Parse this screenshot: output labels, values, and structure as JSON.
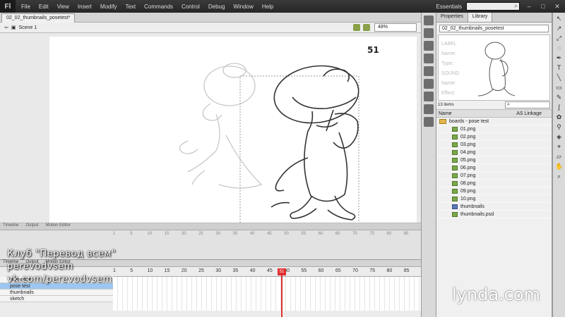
{
  "menubar": {
    "logo": "Fl",
    "items": [
      "File",
      "Edit",
      "View",
      "Insert",
      "Modify",
      "Text",
      "Commands",
      "Control",
      "Debug",
      "Window",
      "Help"
    ],
    "workspace": "Essentials",
    "search_icon": "search-icon"
  },
  "document": {
    "tab_label": "02_02_thumbnails_posetest*",
    "scene_label": "Scene 1",
    "zoom": "48%",
    "frame_badge": "51"
  },
  "timeline_ghost": {
    "tabs": [
      "Timeline",
      "Output",
      "Motion Editor"
    ],
    "ruler": [
      "1",
      "5",
      "10",
      "15",
      "20",
      "25",
      "30",
      "35",
      "40",
      "45",
      "50",
      "55",
      "60",
      "65",
      "70",
      "75",
      "80",
      "85"
    ]
  },
  "timeline": {
    "tabs": [
      "Timeline",
      "Output",
      "Motion Editor"
    ],
    "ruler": [
      "1",
      "5",
      "10",
      "15",
      "20",
      "25",
      "30",
      "35",
      "40",
      "45",
      "50",
      "55",
      "60",
      "65",
      "70",
      "75",
      "80",
      "85"
    ],
    "playhead_frame": "51",
    "layers": [
      "reference",
      "pose test",
      "thumbnails",
      "sketch"
    ]
  },
  "watermark": {
    "line1": "Клуб \"Перевод всем\"",
    "line2": "perevodvsem",
    "line3": "vk.com/perevodvsem"
  },
  "library": {
    "tabs": [
      "Properties",
      "Library"
    ],
    "document": "02_02_thumbnails_posetest",
    "ghost_props": [
      "LABEL",
      "Name:",
      "Type:",
      "SOUND",
      "Name:",
      "Effect:"
    ],
    "item_count": "13 items",
    "col_name": "Name",
    "col_linkage": "AS Linkage",
    "items": [
      {
        "name": "boards - pose test",
        "type": "folder"
      },
      {
        "name": "01.png",
        "type": "img"
      },
      {
        "name": "02.png",
        "type": "img"
      },
      {
        "name": "03.png",
        "type": "img"
      },
      {
        "name": "04.png",
        "type": "img"
      },
      {
        "name": "05.png",
        "type": "img"
      },
      {
        "name": "06.png",
        "type": "img"
      },
      {
        "name": "07.png",
        "type": "img"
      },
      {
        "name": "08.png",
        "type": "img"
      },
      {
        "name": "09.png",
        "type": "img"
      },
      {
        "name": "10.png",
        "type": "img"
      },
      {
        "name": "thumbnails",
        "type": "sym"
      },
      {
        "name": "thumbnails.psd",
        "type": "img"
      }
    ]
  },
  "brand": "lynda.com"
}
